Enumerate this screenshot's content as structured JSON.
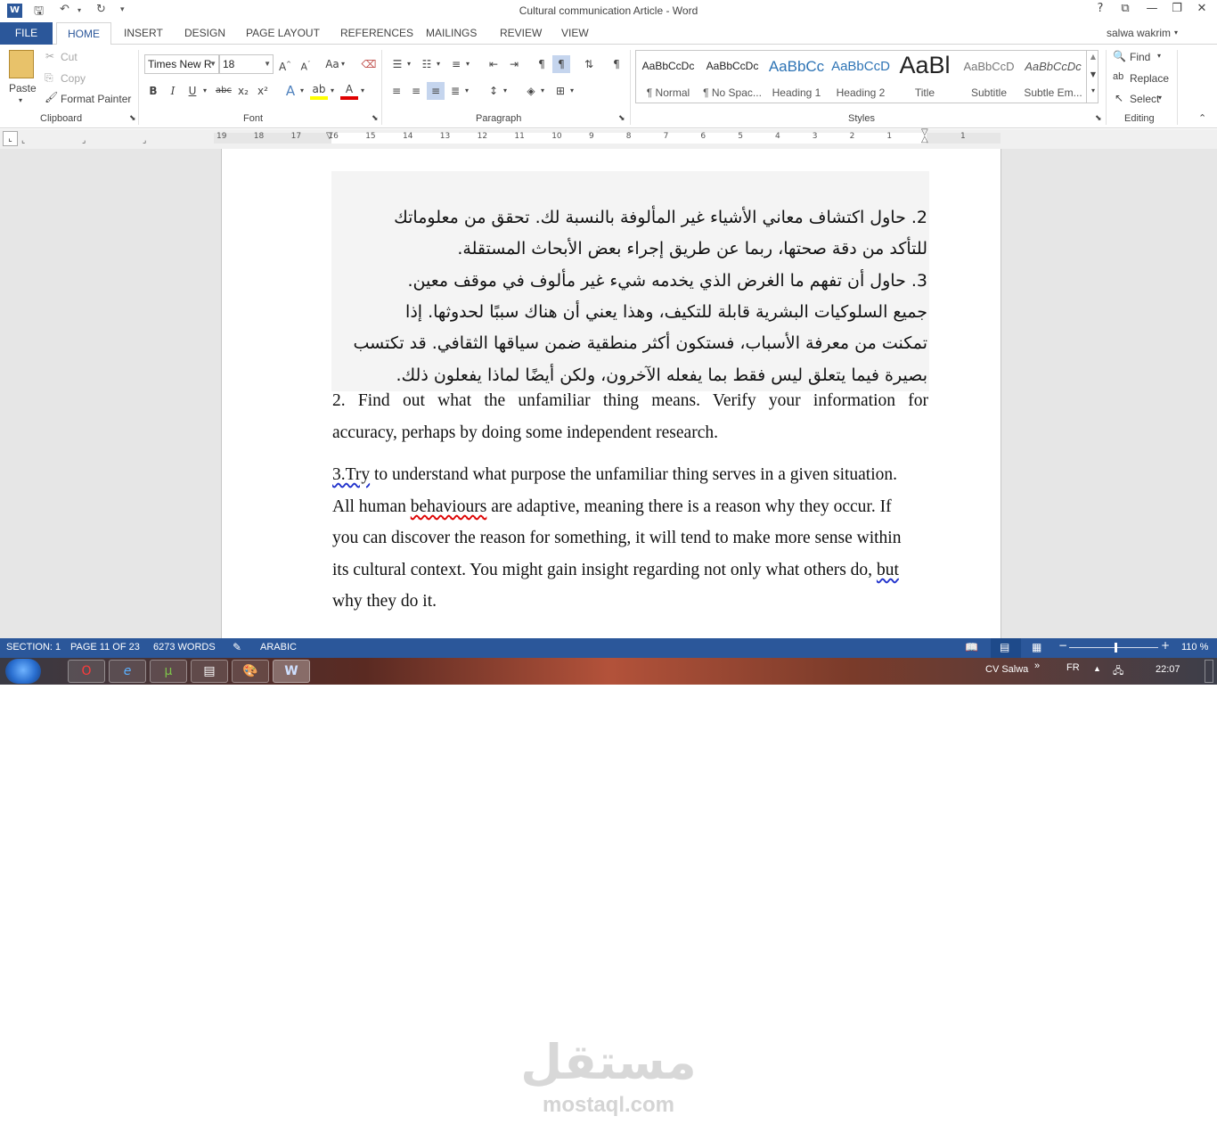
{
  "window": {
    "title": "Cultural communication Article - Word",
    "user_name": "salwa wakrim",
    "help": "?",
    "restore_ribbon": "⧉",
    "minimize": "—",
    "maximize": "❐",
    "close": "✕"
  },
  "quick_access": {
    "icons": [
      "word-app-icon",
      "save-icon",
      "undo-icon",
      "redo-icon",
      "customize-icon"
    ]
  },
  "tabs": [
    "FILE",
    "HOME",
    "INSERT",
    "DESIGN",
    "PAGE LAYOUT",
    "REFERENCES",
    "MAILINGS",
    "REVIEW",
    "VIEW"
  ],
  "clipboard": {
    "paste": "Paste",
    "cut": "Cut",
    "copy": "Copy",
    "format_painter": "Format Painter",
    "label": "Clipboard"
  },
  "font": {
    "name": "Times New R",
    "size": "18",
    "label": "Font",
    "bold": "B",
    "italic": "I",
    "underline": "U",
    "strike": "abc",
    "sub": "x₂",
    "sup": "x²",
    "change_case": "Aa"
  },
  "paragraph": {
    "label": "Paragraph"
  },
  "styles": {
    "label": "Styles",
    "items": [
      {
        "sample": "AaBbCcDc",
        "name": "¶ Normal"
      },
      {
        "sample": "AaBbCcDc",
        "name": "¶ No Spac..."
      },
      {
        "sample": "AaBbCc",
        "name": "Heading 1"
      },
      {
        "sample": "AaBbCcD",
        "name": "Heading 2"
      },
      {
        "sample": "AaBl",
        "name": "Title"
      },
      {
        "sample": "AaBbCcD",
        "name": "Subtitle"
      },
      {
        "sample": "AaBbCcDc",
        "name": "Subtle Em..."
      }
    ]
  },
  "editing": {
    "find": "Find",
    "replace": "Replace",
    "select": "Select",
    "label": "Editing"
  },
  "ruler": {
    "numbers": [
      "19",
      "18",
      "17",
      "16",
      "15",
      "14",
      "13",
      "12",
      "11",
      "10",
      "9",
      "8",
      "7",
      "6",
      "5",
      "4",
      "3",
      "2",
      "1",
      "1"
    ]
  },
  "document": {
    "arabic_lines": [
      "2. حاول اكتشاف معاني الأشياء غير المألوفة بالنسبة لك. تحقق من معلوماتك",
      "للتأكد من دقة صحتها، ربما عن طريق إجراء بعض الأبحاث المستقلة.",
      "3. حاول أن تفهم ما الغرض الذي يخدمه شيء غير مألوف في موقف معين.",
      "جميع السلوكيات البشرية قابلة للتكيف، وهذا يعني أن هناك سببًا لحدوثها. إذا",
      "تمكنت من معرفة الأسباب، فستكون أكثر منطقية ضمن سياقها الثقافي. قد تكتسب",
      "بصيرة فيما يتعلق ليس فقط بما يفعله الآخرون، ولكن أيضًا لماذا يفعلون ذلك."
    ],
    "en_p1": [
      "2. Find out what the unfamiliar thing means. Verify your information for",
      "accuracy, perhaps by doing some independent research."
    ],
    "en_p2": {
      "l1_a": "3.Try",
      "l1_b": " to understand what purpose the unfamiliar thing serves in a given situation.",
      "l2_a": "All human ",
      "l2_b": "behaviours",
      "l2_c": " are adaptive, meaning there is a reason why they occur. If",
      "l3": "you can discover the reason for something, it will tend to make more sense within",
      "l4_a": "its cultural context. You might gain insight regarding not only what others do, ",
      "l4_b": "but",
      "l5": "why they do it."
    }
  },
  "status": {
    "section": "SECTION: 1",
    "page": "PAGE 11 OF 23",
    "words": "6273 WORDS",
    "language": "ARABIC",
    "zoom": "110 %",
    "zoom_level": 0.52
  },
  "taskbar": {
    "apps": [
      "opera-icon",
      "ie-icon",
      "utorrent-icon",
      "notepad-icon",
      "paint-icon",
      "word-icon"
    ],
    "user": "CV Salwa",
    "lang": "FR",
    "time": "22:07"
  },
  "watermark": {
    "arabic": "مستقل",
    "latin": "mostaql.com"
  }
}
